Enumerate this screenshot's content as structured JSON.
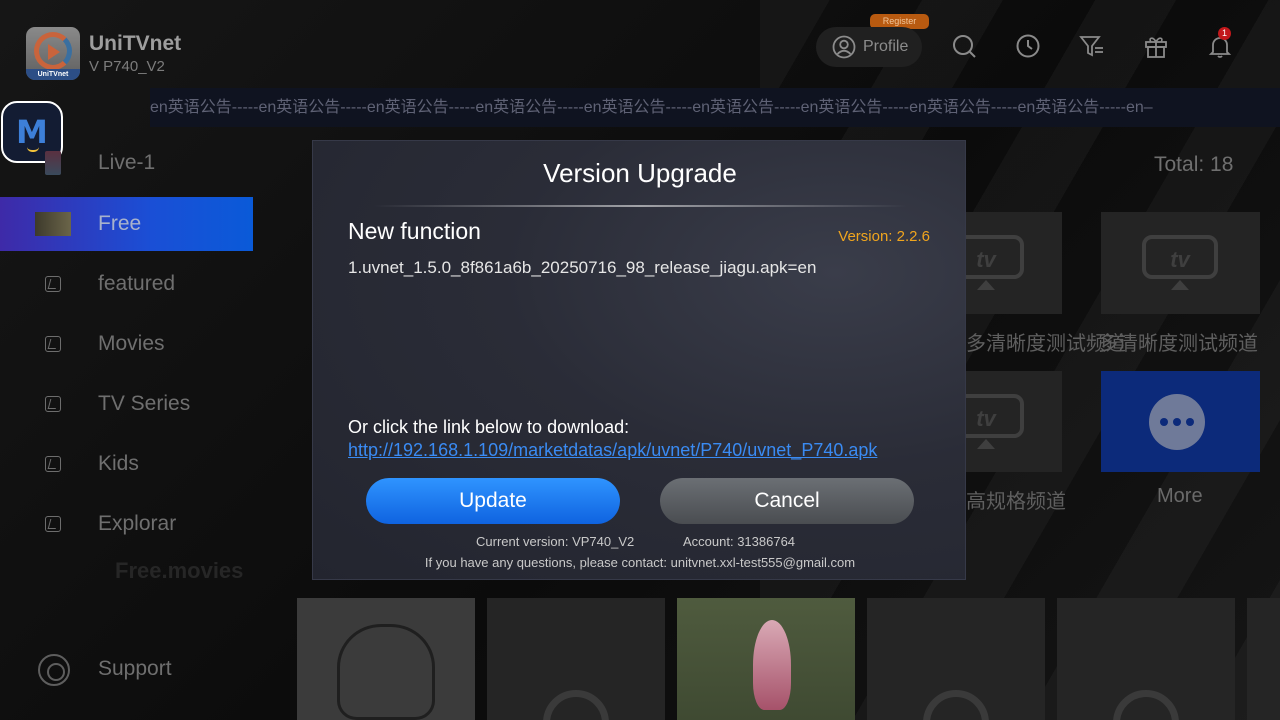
{
  "app": {
    "name": "UniTVnet",
    "version": "V P740_V2",
    "logo_label": "UniTVnet"
  },
  "header": {
    "register_tag": "Register",
    "profile_label": "Profile",
    "icons": [
      "user-icon",
      "search-icon",
      "history-icon",
      "filter-icon",
      "gift-icon",
      "bell-icon"
    ],
    "notification_count": "1"
  },
  "marquee": {
    "text": "en英语公告-----en英语公告-----en英语公告-----en英语公告-----en英语公告-----en英语公告-----en英语公告-----en英语公告-----en英语公告-----en–"
  },
  "sidebar": {
    "items": [
      {
        "label": "Live-1"
      },
      {
        "label": "Free"
      },
      {
        "label": "featured"
      },
      {
        "label": "Movies"
      },
      {
        "label": "TV Series"
      },
      {
        "label": "Kids"
      },
      {
        "label": "Explorar"
      }
    ],
    "active_index": 1,
    "support_label": "Support"
  },
  "content": {
    "total": "Total: 18",
    "tiles": [
      {
        "label": "多清晰度测试频道"
      },
      {
        "label": "多清晰度测试频道"
      },
      {
        "label": "高规格频道"
      },
      {
        "label": "More"
      }
    ],
    "section_title": "Free.movies"
  },
  "dialog": {
    "title": "Version Upgrade",
    "new_function_heading": "New function",
    "version": "Version: 2.2.6",
    "change_log": "1.uvnet_1.5.0_8f861a6b_20250716_98_release_jiagu.apk=en",
    "link_intro": "Or click the link below to download:",
    "link_url": "http://192.168.1.109/marketdatas/apk/uvnet/P740/uvnet_P740.apk",
    "update_label": "Update",
    "cancel_label": "Cancel",
    "current_version": "Current version: VP740_V2",
    "account": "Account: 31386764",
    "contact": "If you have any questions, please contact: unitvnet.xxl-test555@gmail.com"
  },
  "colors": {
    "accent_blue": "#1a74f0",
    "version_orange": "#f0a51e",
    "link_blue": "#3a8bf3",
    "sidebar_active_start": "#3e2aa8",
    "sidebar_active_end": "#0a5ad8"
  }
}
